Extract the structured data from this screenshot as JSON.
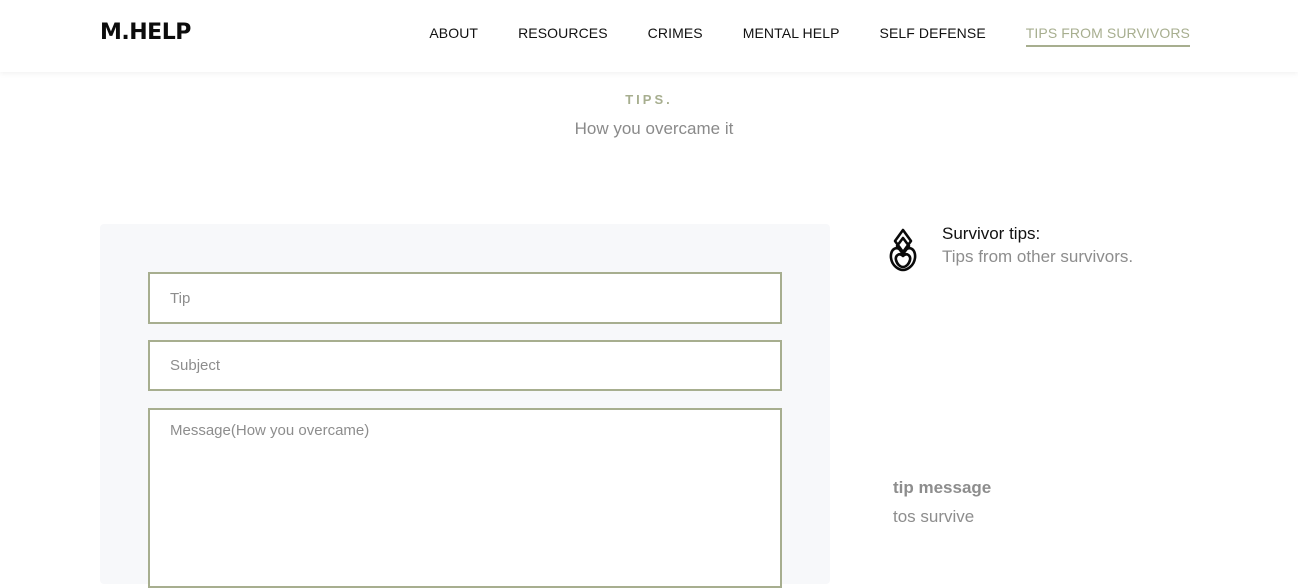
{
  "brand": {
    "logo": "M.HELP"
  },
  "nav": {
    "items": [
      {
        "label": "ABOUT"
      },
      {
        "label": "RESOURCES"
      },
      {
        "label": "CRIMES"
      },
      {
        "label": "MENTAL HELP"
      },
      {
        "label": "SELF DEFENSE"
      },
      {
        "label": "TIPS FROM SURVIVORS"
      }
    ],
    "active": "TIPS FROM SURVIVORS"
  },
  "section": {
    "label": "TIPS.",
    "subtitle": "How you overcame it"
  },
  "form": {
    "tip_placeholder": "Tip",
    "subject_placeholder": "Subject",
    "message_placeholder": "Message(How you overcame)"
  },
  "info": {
    "icon": "lotus-icon",
    "title": "Survivor tips:",
    "description": "Tips from other survivors."
  },
  "tips": [
    {
      "heading": "tip message",
      "text": "tos survive"
    }
  ],
  "colors": {
    "accent": "#a7ae8f",
    "panel_background": "#f7f8fa",
    "muted_text": "#8d8d8d"
  }
}
